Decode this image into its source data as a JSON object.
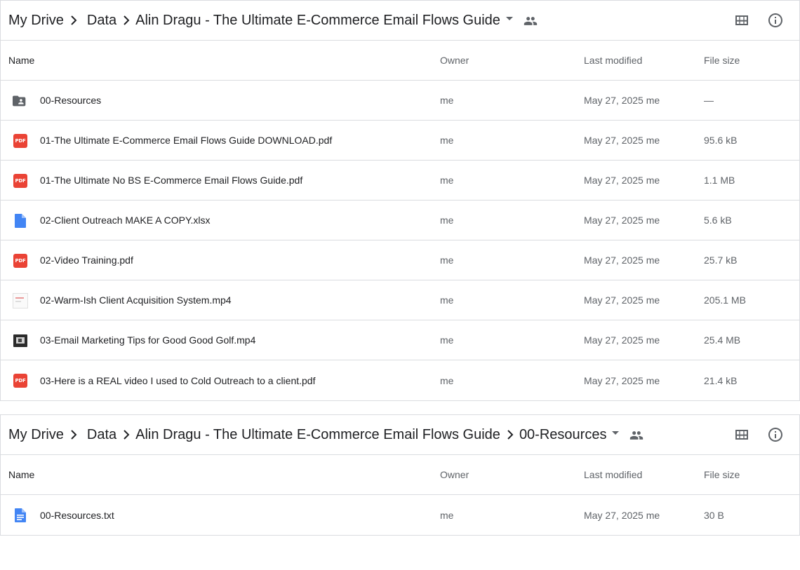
{
  "colors": {
    "pdf_red": "#ea4335",
    "docs_blue": "#4285f4",
    "folder_gray": "#5f6368",
    "border": "#dadce0"
  },
  "panels": [
    {
      "breadcrumb": [
        "My Drive",
        "Data",
        "Alin Dragu - The Ultimate E-Commerce Email Flows Guide"
      ],
      "columns": {
        "name": "Name",
        "owner": "Owner",
        "modified": "Last modified",
        "size": "File size"
      },
      "rows": [
        {
          "icon": "shared-folder-icon",
          "name": "00-Resources",
          "owner": "me",
          "modified": "May 27, 2025 me",
          "size": "—"
        },
        {
          "icon": "pdf-icon",
          "name": "01-The Ultimate E-Commerce Email Flows Guide DOWNLOAD.pdf",
          "owner": "me",
          "modified": "May 27, 2025 me",
          "size": "95.6 kB"
        },
        {
          "icon": "pdf-icon",
          "name": "01-The Ultimate No BS E-Commerce Email Flows Guide.pdf",
          "owner": "me",
          "modified": "May 27, 2025 me",
          "size": "1.1 MB"
        },
        {
          "icon": "file-icon",
          "name": "02-Client Outreach MAKE A COPY.xlsx",
          "owner": "me",
          "modified": "May 27, 2025 me",
          "size": "5.6 kB"
        },
        {
          "icon": "pdf-icon",
          "name": "02-Video Training.pdf",
          "owner": "me",
          "modified": "May 27, 2025 me",
          "size": "25.7 kB"
        },
        {
          "icon": "video-thumbnail-light-icon",
          "name": "02-Warm-Ish Client Acquisition System.mp4",
          "owner": "me",
          "modified": "May 27, 2025 me",
          "size": "205.1 MB"
        },
        {
          "icon": "video-thumbnail-dark-icon",
          "name": "03-Email Marketing Tips for Good Good Golf.mp4",
          "owner": "me",
          "modified": "May 27, 2025 me",
          "size": "25.4 MB"
        },
        {
          "icon": "pdf-icon",
          "name": "03-Here is a REAL video I used to Cold Outreach to a client.pdf",
          "owner": "me",
          "modified": "May 27, 2025 me",
          "size": "21.4 kB"
        }
      ]
    },
    {
      "breadcrumb": [
        "My Drive",
        "Data",
        "Alin Dragu - The Ultimate E-Commerce Email Flows Guide",
        "00-Resources"
      ],
      "columns": {
        "name": "Name",
        "owner": "Owner",
        "modified": "Last modified",
        "size": "File size"
      },
      "rows": [
        {
          "icon": "text-document-icon",
          "name": "00-Resources.txt",
          "owner": "me",
          "modified": "May 27, 2025 me",
          "size": "30 B"
        }
      ]
    }
  ],
  "pdf_label": "PDF"
}
